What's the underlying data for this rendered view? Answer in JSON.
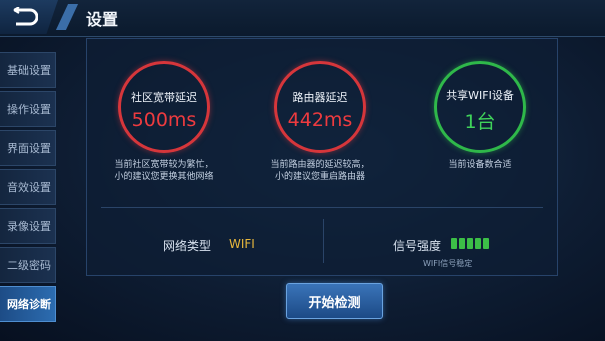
{
  "header": {
    "title": "设置"
  },
  "sidebar": {
    "items": [
      {
        "label": "基础设置",
        "active": false
      },
      {
        "label": "操作设置",
        "active": false
      },
      {
        "label": "界面设置",
        "active": false
      },
      {
        "label": "音效设置",
        "active": false
      },
      {
        "label": "录像设置",
        "active": false
      },
      {
        "label": "二级密码",
        "active": false
      },
      {
        "label": "网络诊断",
        "active": true
      }
    ]
  },
  "diagnostics": [
    {
      "label": "社区宽带延迟",
      "value": "500ms",
      "status": "red",
      "desc_line1": "当前社区宽带较为繁忙，",
      "desc_line2": "小的建议您更换其他网络"
    },
    {
      "label": "路由器延迟",
      "value": "442ms",
      "status": "red",
      "desc_line1": "当前路由器的延迟较高，",
      "desc_line2": "小的建议您重启路由器"
    },
    {
      "label": "共享WIFI设备",
      "value": "1台",
      "status": "green",
      "desc_line1": "当前设备数合适",
      "desc_line2": ""
    }
  ],
  "network": {
    "type_label": "网络类型",
    "type_value": "WIFI",
    "signal_label": "信号强度",
    "signal_bars": 5,
    "signal_note": "WIFI信号稳定"
  },
  "actions": {
    "start_label": "开始检测"
  },
  "colors": {
    "red": "#d6363b",
    "green": "#2fb84a",
    "accent": "#e7b73c"
  }
}
